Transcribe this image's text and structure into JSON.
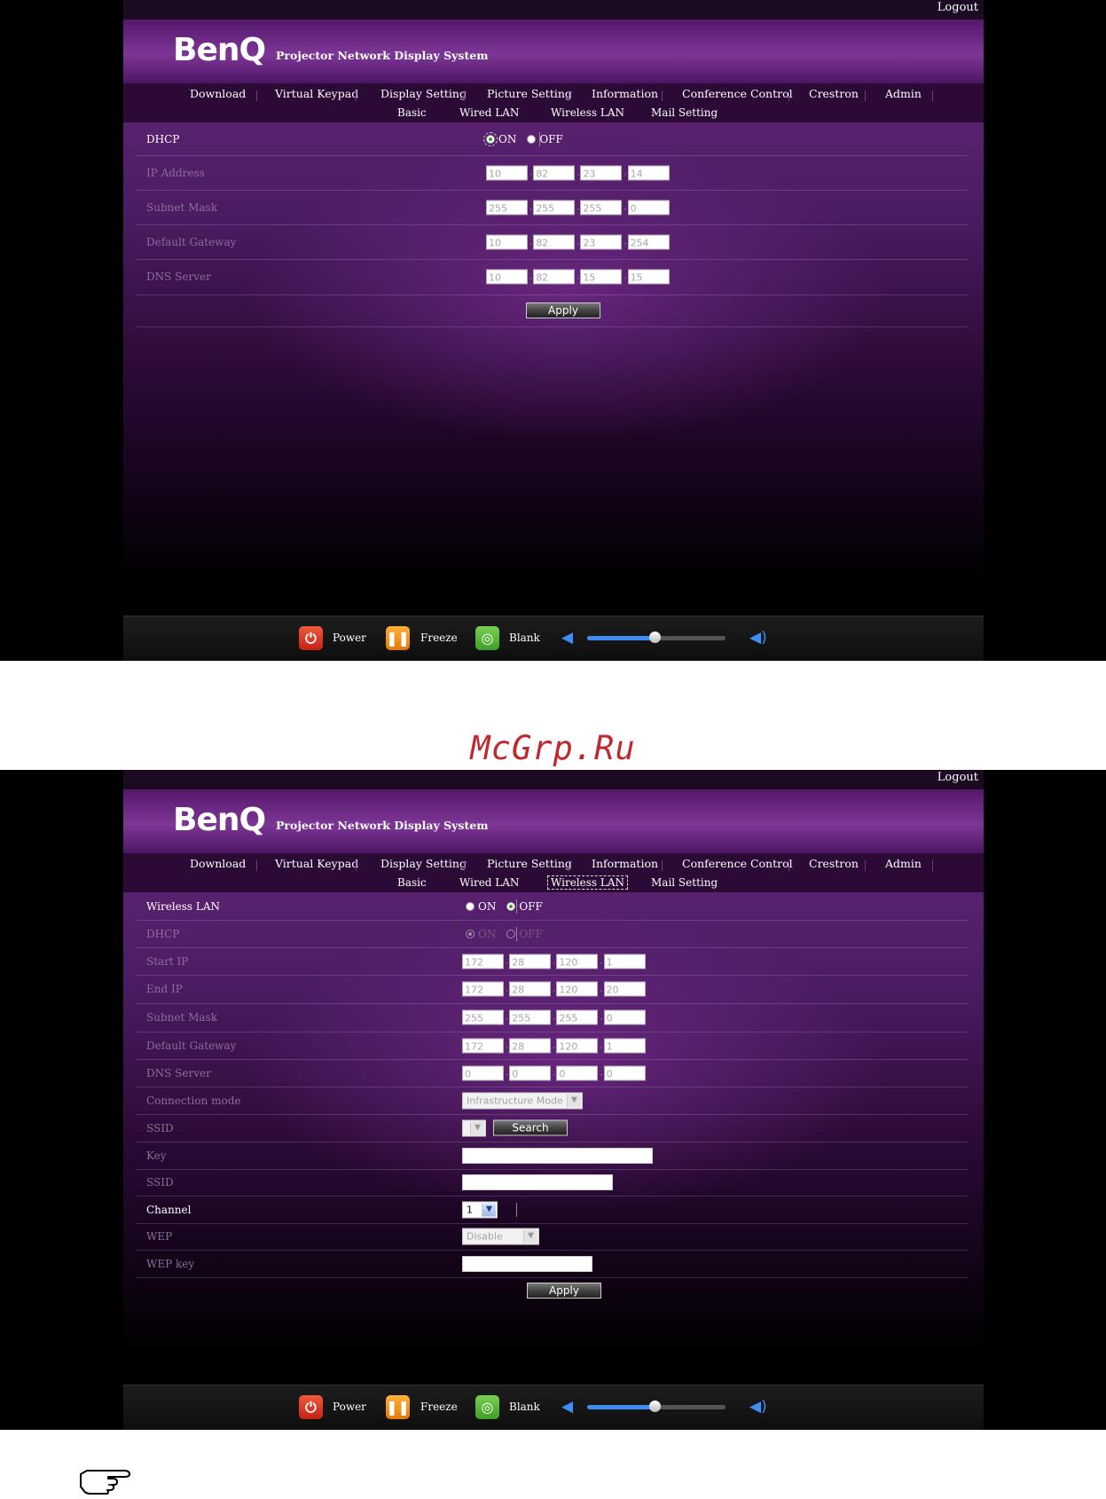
{
  "watermark": "McGrp.Ru",
  "colors": {
    "accent_purple": "#5a2270",
    "volume_blue": "#3e8df2",
    "power_red": "#d8331f",
    "freeze_orange": "#f2931c",
    "blank_green": "#57b534"
  },
  "common": {
    "logout": "Logout",
    "brand": "BenQ",
    "subtitle": "Projector Network Display System",
    "main_nav": [
      "Download",
      "Virtual Keypad",
      "Display Setting",
      "Picture Setting",
      "Information",
      "Conference Control",
      "Crestron",
      "Admin"
    ],
    "sub_nav": [
      "Basic",
      "Wired LAN",
      "Wireless LAN",
      "Mail Setting"
    ],
    "footer": {
      "power": "Power",
      "freeze": "Freeze",
      "blank": "Blank",
      "volume_level": 0.49
    }
  },
  "wired": {
    "active_sub_tab": "Wired LAN",
    "dhcp": {
      "label": "DHCP",
      "on": "ON",
      "off": "OFF",
      "selected": "ON"
    },
    "ip_address": {
      "label": "IP Address",
      "values": [
        "10",
        "82",
        "23",
        "14"
      ]
    },
    "subnet_mask": {
      "label": "Subnet Mask",
      "values": [
        "255",
        "255",
        "255",
        "0"
      ]
    },
    "default_gateway": {
      "label": "Default Gateway",
      "values": [
        "10",
        "82",
        "23",
        "254"
      ]
    },
    "dns_server": {
      "label": "DNS Server",
      "values": [
        "10",
        "82",
        "15",
        "15"
      ]
    },
    "apply": "Apply"
  },
  "wireless": {
    "active_sub_tab": "Wireless LAN",
    "wireless_lan": {
      "label": "Wireless LAN",
      "on": "ON",
      "off": "OFF",
      "selected": "OFF"
    },
    "dhcp": {
      "label": "DHCP",
      "on": "ON",
      "off": "OFF",
      "selected": "ON"
    },
    "start_ip": {
      "label": "Start IP",
      "values": [
        "172",
        "28",
        "120",
        "1"
      ]
    },
    "end_ip": {
      "label": "End IP",
      "values": [
        "172",
        "28",
        "120",
        "20"
      ]
    },
    "subnet_mask": {
      "label": "Subnet Mask",
      "values": [
        "255",
        "255",
        "255",
        "0"
      ]
    },
    "default_gateway": {
      "label": "Default Gateway",
      "values": [
        "172",
        "28",
        "120",
        "1"
      ]
    },
    "dns_server": {
      "label": "DNS Server",
      "values": [
        "0",
        "0",
        "0",
        "0"
      ]
    },
    "connection_mode": {
      "label": "Connection mode",
      "value": "Infrastructure Mode"
    },
    "ssid_scan": {
      "label": "SSID",
      "value": "",
      "search": "Search"
    },
    "key": {
      "label": "Key",
      "value": ""
    },
    "ssid": {
      "label": "SSID",
      "value": ""
    },
    "channel": {
      "label": "Channel",
      "value": "1"
    },
    "wep": {
      "label": "WEP",
      "value": "Disable"
    },
    "wep_key": {
      "label": "WEP key",
      "value": ""
    },
    "apply": "Apply"
  }
}
